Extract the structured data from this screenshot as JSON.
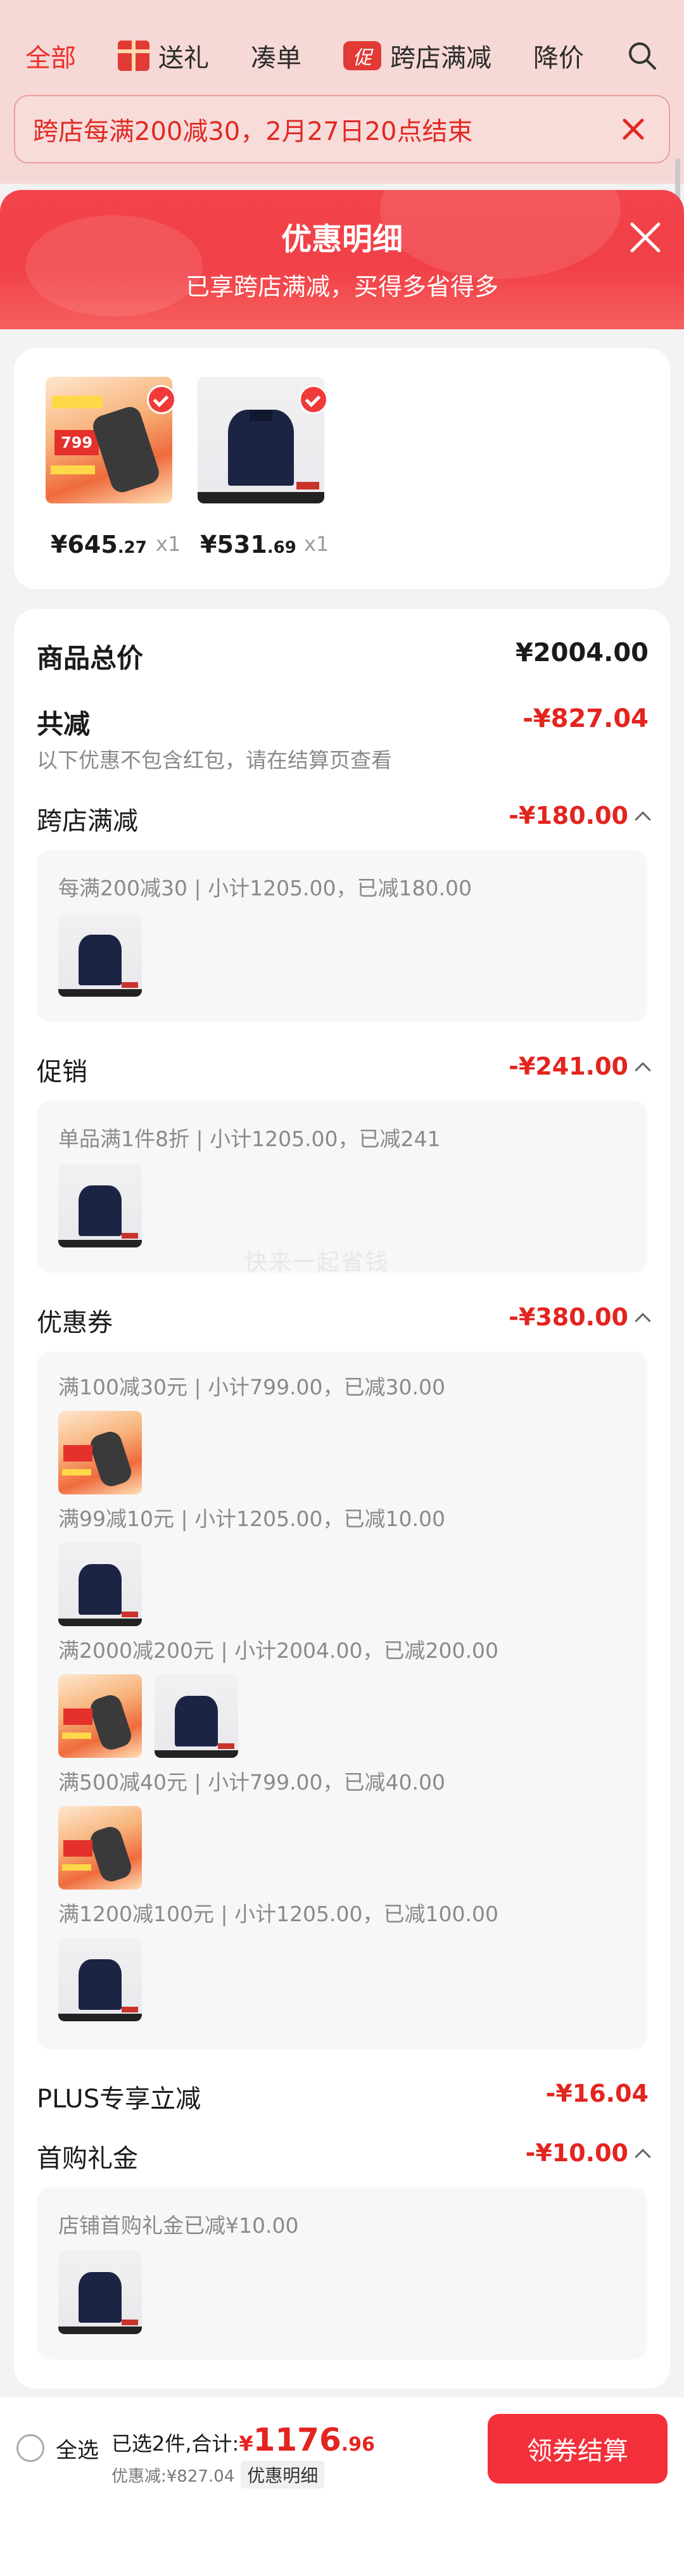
{
  "nav": {
    "items": [
      {
        "label": "全部",
        "active": true
      },
      {
        "label": "送礼",
        "icon": "gift-icon"
      },
      {
        "label": "凑单"
      },
      {
        "label": "跨店满减",
        "badge": "促"
      },
      {
        "label": "降价"
      }
    ],
    "search_icon": "search-icon"
  },
  "notice": {
    "text": "跨店每满200减30，2月27日20点结束"
  },
  "sheet": {
    "title": "优惠明细",
    "subtitle": "已享跨店满减，买得多省得多"
  },
  "products": [
    {
      "price_main": "¥645",
      "price_dec": ".27",
      "qty": "x1",
      "thumb_text": "799"
    },
    {
      "price_main": "¥531",
      "price_dec": ".69",
      "qty": "x1"
    }
  ],
  "summary": {
    "total_label": "商品总价",
    "total_value": "¥2004.00",
    "discount_label": "共减",
    "discount_value": "-¥827.04",
    "note": "以下优惠不包含红包，请在结算页查看"
  },
  "sections": [
    {
      "key": "cross_store",
      "label": "跨店满减",
      "value": "-¥180.00",
      "lines": [
        "每满200减30 | 小计1205.00，已减180.00"
      ]
    },
    {
      "key": "promotion",
      "label": "促销",
      "value": "-¥241.00",
      "lines": [
        "单品满1件8折 | 小计1205.00，已减241"
      ]
    },
    {
      "key": "coupon",
      "label": "优惠券",
      "value": "-¥380.00",
      "lines": [
        "满100减30元 | 小计799.00，已减30.00",
        "满99减10元 | 小计1205.00，已减10.00",
        "满2000减200元 | 小计2004.00，已减200.00",
        "满500减40元 | 小计799.00，已减40.00",
        "满1200减100元 | 小计1205.00，已减100.00"
      ]
    },
    {
      "key": "plus",
      "label": "PLUS专享立减",
      "value": "-¥16.04"
    },
    {
      "key": "first_gift",
      "label": "首购礼金",
      "value": "-¥10.00",
      "lines": [
        "店铺首购礼金已减¥10.00"
      ]
    }
  ],
  "watermark": "快来一起省钱",
  "footer": {
    "select_all": "全选",
    "selected_text": "已选2件,合计:",
    "currency": "¥",
    "amount_main": "1176",
    "amount_dec": ".96",
    "discount_text": "优惠减:¥827.04",
    "detail_chip": "优惠明细",
    "checkout": "领券结算"
  },
  "colors": {
    "accent": "#e3241f",
    "header_red": "#f2444a",
    "button": "#f3303a"
  }
}
